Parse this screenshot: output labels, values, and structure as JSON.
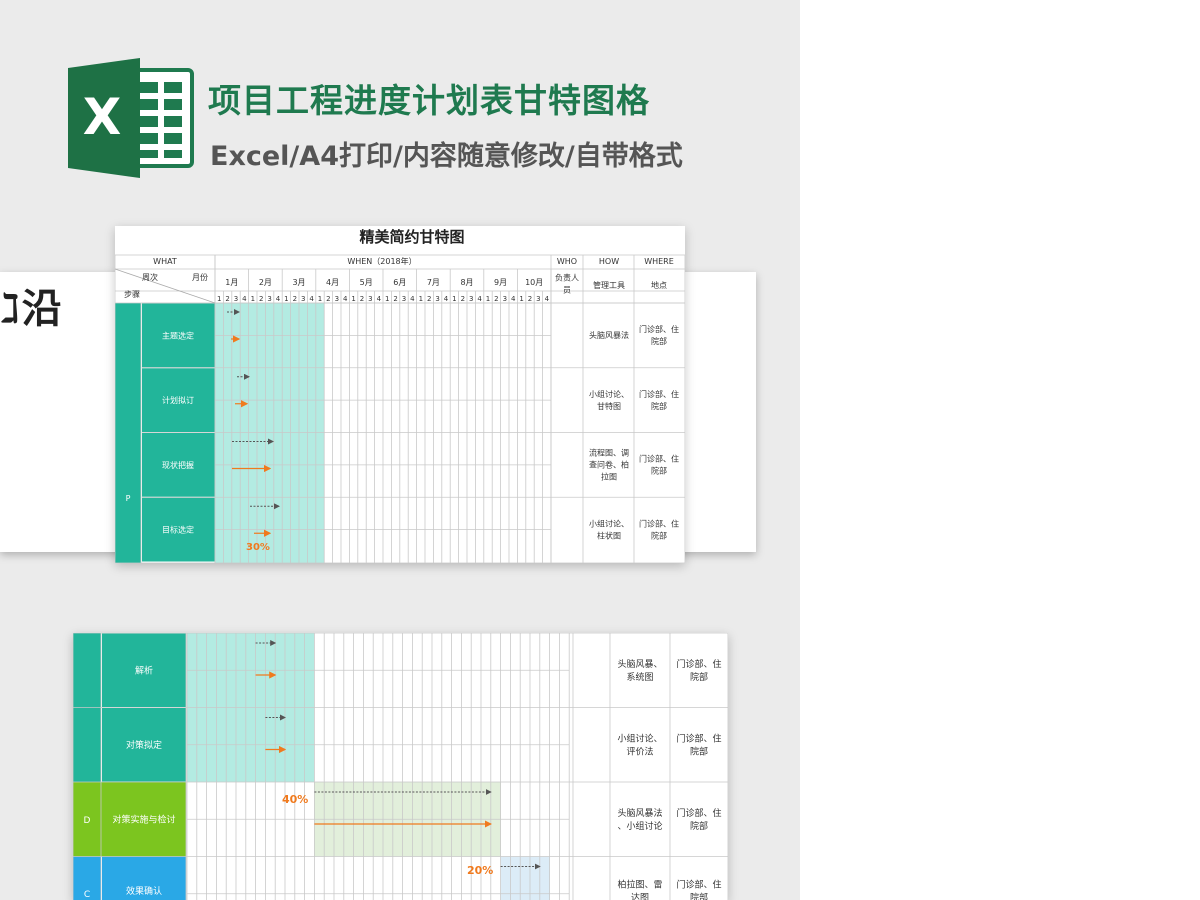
{
  "header": {
    "title": "项目工程进度计划表甘特图格",
    "subtitle": "Excel/A4打印/内容随意修改/自带格式",
    "logo_letter": "X"
  },
  "back_sheet": {
    "fragment": "ℷ沿"
  },
  "colors": {
    "title_green": "#1f7a4f",
    "teal": "#22b59a",
    "teal_light": "#b3ebe2",
    "lime": "#7cc51f",
    "green_light": "#e2efdb",
    "blue": "#2aa8e6",
    "blue_light": "#dcecf7",
    "orange": "#f07a1e",
    "grid": "#c9c9c9"
  },
  "card1": {
    "sheet_title": "精美简约甘特图",
    "headers": {
      "what": "WHAT",
      "when": "WHEN（2018年）",
      "who": "WHO",
      "how": "HOW",
      "where": "WHERE",
      "zhouci": "周次",
      "yuefen": "月份",
      "buzhou": "步骤",
      "who_sub": "负责人员",
      "how_sub": "管理工具",
      "where_sub": "地点"
    },
    "months": [
      "1月",
      "2月",
      "3月",
      "4月",
      "5月",
      "6月",
      "7月",
      "8月",
      "9月",
      "10月"
    ],
    "weeks": [
      "1",
      "2",
      "3",
      "4"
    ],
    "phase": "P",
    "tasks": [
      {
        "name": "主题选定",
        "how": "头脑风暴法",
        "where": "门诊部、住院部"
      },
      {
        "name": "计划拟订",
        "how": "小组讨论、甘特图",
        "where": "门诊部、住院部"
      },
      {
        "name": "现状把握",
        "how": "流程图、调查问卷、柏拉图",
        "where": "门诊部、住院部"
      },
      {
        "name": "目标选定",
        "how": "小组讨论、柱状图",
        "where": "门诊部、住院部"
      }
    ],
    "percent": "30%"
  },
  "card2": {
    "tasks": [
      {
        "name": "解析",
        "how": "头脑风暴、系统图",
        "where": "门诊部、住院部"
      },
      {
        "name": "对策拟定",
        "how": "小组讨论、评价法",
        "where": "门诊部、住院部"
      },
      {
        "name": "对策实施与检讨",
        "phase": "D",
        "how": "头脑风暴法、小组讨论",
        "where": "门诊部、住院部"
      },
      {
        "name": "效果确认",
        "phase": "C",
        "how": "柏拉图、雷达图",
        "where": "门诊部、住院部"
      }
    ],
    "percent_d": "40%",
    "percent_c": "20%"
  }
}
